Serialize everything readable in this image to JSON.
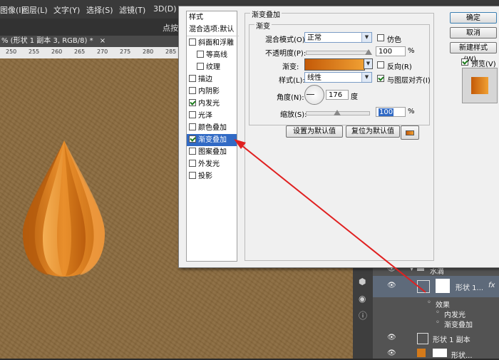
{
  "menubar": {
    "items": [
      {
        "label": "图像(I)"
      },
      {
        "label": "图层(L)"
      },
      {
        "label": "文字(Y)"
      },
      {
        "label": "选择(S)"
      },
      {
        "label": "滤镜(T)"
      },
      {
        "label": "3D(D)"
      }
    ]
  },
  "options_bar": {
    "right_text": "点按:"
  },
  "document_tab": {
    "title": "% (形状 1 副本 3, RGB/8) *",
    "close": "×"
  },
  "ruler": {
    "ticks": [
      "250",
      "255",
      "260",
      "265",
      "270",
      "275",
      "280",
      "285"
    ]
  },
  "dialog": {
    "styles_header": "样式",
    "blending_options": "混合选项:默认",
    "styles": [
      {
        "label": "斜面和浮雕",
        "checked": false,
        "indent": false
      },
      {
        "label": "等高线",
        "checked": false,
        "indent": true
      },
      {
        "label": "纹理",
        "checked": false,
        "indent": true
      },
      {
        "label": "描边",
        "checked": false,
        "indent": false
      },
      {
        "label": "内阴影",
        "checked": false,
        "indent": false
      },
      {
        "label": "内发光",
        "checked": true,
        "indent": false
      },
      {
        "label": "光泽",
        "checked": false,
        "indent": false
      },
      {
        "label": "颜色叠加",
        "checked": false,
        "indent": false
      },
      {
        "label": "渐变叠加",
        "checked": true,
        "indent": false,
        "selected": true
      },
      {
        "label": "图案叠加",
        "checked": false,
        "indent": false
      },
      {
        "label": "外发光",
        "checked": false,
        "indent": false
      },
      {
        "label": "投影",
        "checked": false,
        "indent": false
      }
    ],
    "section_title": "渐变叠加",
    "group_title": "渐变",
    "blend_mode_label": "混合模式(O):",
    "blend_mode_value": "正常",
    "dither_label": "仿色",
    "opacity_label": "不透明度(P):",
    "opacity_value": "100",
    "opacity_unit": "%",
    "opacity_level": 1.0,
    "gradient_label": "渐变:",
    "reverse_label": "反向(R)",
    "style_label": "样式(L):",
    "style_value": "线性",
    "align_label": "与图层对齐(I)",
    "align_checked": true,
    "angle_label": "角度(N):",
    "angle_value": "176",
    "angle_unit": "度",
    "scale_label": "缩放(S):",
    "scale_value": "100",
    "scale_unit": "%",
    "scale_level": 0.5,
    "set_default": "设置为默认值",
    "reset_default": "复位为默认值",
    "ok": "确定",
    "cancel": "取消",
    "new_style": "新建样式(W)...",
    "preview_label": "预览(V)",
    "preview_checked": true,
    "gradient_colors": [
      "#c45a08",
      "#f0a033"
    ]
  },
  "layers": {
    "group_name": "水滴",
    "layer1_name": "形状 1...",
    "fx": "fx",
    "effects_label": "效果",
    "effect1": "内发光",
    "effect2": "渐变叠加",
    "layer2_name": "形状 1 副本",
    "layer3_name": "形状..."
  },
  "colors": {
    "accent": "#316ac5",
    "arrow": "#e02020",
    "drop_dark": "#c0620e",
    "drop_light": "#f3a84a"
  }
}
